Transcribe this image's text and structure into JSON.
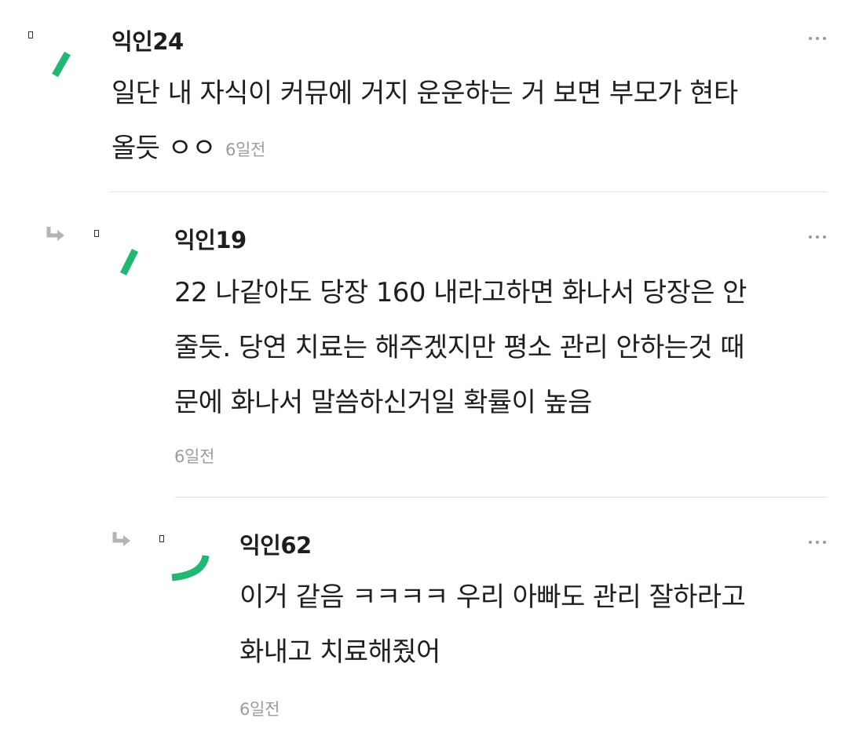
{
  "colors": {
    "accent_green": "#20b873",
    "meta_gray": "#9b9b9b",
    "divider": "#e2e2e2"
  },
  "comments": [
    {
      "author": "익인24",
      "lines": [
        "일단 내 자식이 커뮤에 거지 운운하는 거 보면 부모가 현타",
        "올듯 ㅇㅇ"
      ],
      "time": "6일전",
      "is_reply": false,
      "icons": [
        "lock-icon",
        "avatar-icon",
        "more-options-icon"
      ]
    },
    {
      "author": "익인19",
      "lines": [
        "22 나같아도 당장 160 내라고하면 화나서 당장은 안",
        "줄듯. 당연 치료는 해주겠지만 평소 관리 안하는것 때",
        "문에 화나서 말씀하신거일 확률이 높음"
      ],
      "time": "6일전",
      "is_reply": true,
      "icons": [
        "reply-arrow-icon",
        "lock-icon",
        "avatar-icon",
        "more-options-icon"
      ]
    },
    {
      "author": "익인62",
      "lines": [
        "이거 같음 ㅋㅋㅋㅋ 우리 아빠도 관리 잘하라고",
        "화내고 치료해줬어"
      ],
      "time": "6일전",
      "is_reply": true,
      "icons": [
        "reply-arrow-icon",
        "lock-icon",
        "avatar-icon",
        "more-options-icon"
      ]
    }
  ]
}
